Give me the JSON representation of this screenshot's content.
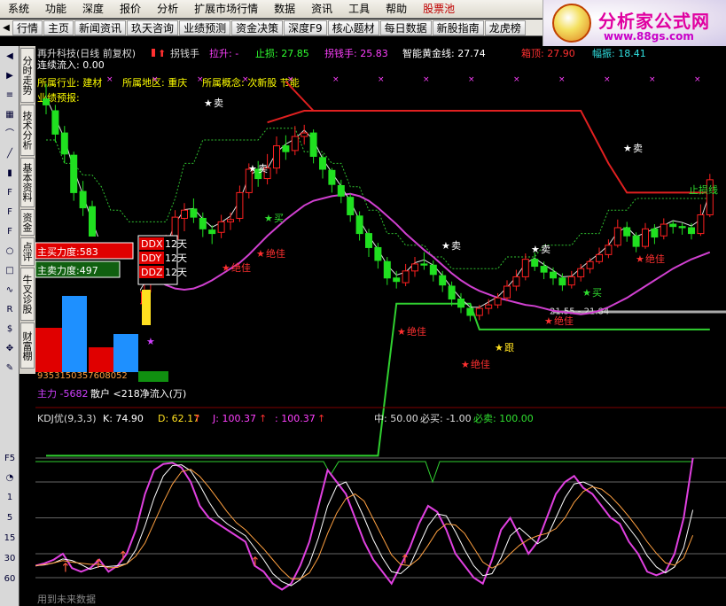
{
  "menu": [
    "系统",
    "功能",
    "深度",
    "报价",
    "分析",
    "扩展市场行情",
    "数据",
    "资讯",
    "工具",
    "帮助",
    "股票池"
  ],
  "tabs": [
    "行情",
    "主页",
    "新闻资讯",
    "玖天咨询",
    "业绩预测",
    "资金决策",
    "深度F9",
    "核心题材",
    "每日数据",
    "新股指南",
    "龙虎榜"
  ],
  "logo": {
    "title": "分析家公式网",
    "url": "www.88gs.com"
  },
  "left_tabs": [
    "分时走势",
    "技术分析",
    "基本资料",
    "资金",
    "点评",
    "牛叉诊股",
    "财富棚"
  ],
  "toolbar_icons": [
    "back-icon",
    "forward-icon",
    "list-icon",
    "grid-icon",
    "chart-icon",
    "line-icon",
    "bar-icon",
    "f10-icon",
    "f-icon",
    "f12-icon",
    "circle-icon",
    "square-icon",
    "wave-icon",
    "rsi-icon",
    "dollar-icon",
    "move-icon",
    "pen-icon",
    "f5-icon",
    "clock-icon",
    "num-icon"
  ],
  "toolbar_nums": [
    "1",
    "5",
    "15",
    "30",
    "60"
  ],
  "main_chart": {
    "title": "再升科技(日线 前复权)",
    "indicator": "拐钱手",
    "lashang": "拉升: -",
    "zhisun": "止损: 27.85",
    "guaiqianshou": "拐钱手: 25.83",
    "zhineng": "智能黄金线: 27.74",
    "xiangding": "箱顶: 27.90",
    "xiangfu": "幅振: 18.41",
    "lianxu": "连续流入: 0.00",
    "hangye": "所属行业: 建材",
    "diqu": "所属地区: 重庆",
    "gainian": "所属概念: 次新股 节能",
    "yeji": "业绩预报:",
    "price_label": "21.55 - 21.84",
    "zhisunxian": "止损线"
  },
  "signals": {
    "sell": "卖",
    "buy": "买",
    "best": "绝佳",
    "follow": "跟"
  },
  "ddx": {
    "ddx": "DDX",
    "ddy": "DDY",
    "ddz": "DDZ",
    "days": "12天",
    "zhumai": "主买力度:583",
    "zhumai2": "主卖力度:497",
    "nums": "9353150357608052",
    "zhuli": "主力 -5682",
    "sanhu": "散户 <218净流入(万)"
  },
  "kdj": {
    "name": "KDJ优(9,3,3)",
    "k": "K: 74.90",
    "d": "D: 62.17",
    "j": "J: 100.37",
    "j2": ": 100.37",
    "zhong": "中: 50.00",
    "bimai": "必买: -1.00",
    "bimai2": "必卖: 100.00",
    "future": "用到未来数据"
  },
  "chart_data": {
    "type": "candlestick",
    "candles": [
      [
        39.5,
        39.0,
        40.8,
        38.2
      ],
      [
        38.5,
        36.5,
        39.0,
        35.8
      ],
      [
        36.6,
        34.8,
        37.2,
        34.0
      ],
      [
        34.7,
        31.5,
        35.0,
        30.8
      ],
      [
        31.6,
        30.2,
        32.5,
        29.5
      ],
      [
        30.3,
        27.0,
        30.8,
        26.2
      ],
      [
        27.0,
        26.1,
        27.5,
        25.1
      ],
      [
        26.2,
        25.0,
        26.9,
        24.2
      ],
      [
        25.1,
        23.2,
        25.8,
        22.9
      ],
      [
        23.3,
        21.9,
        23.9,
        21.4
      ],
      [
        22.0,
        23.0,
        23.5,
        21.5
      ],
      [
        23.0,
        24.6,
        25.0,
        22.8
      ],
      [
        24.7,
        25.6,
        26.3,
        24.4
      ],
      [
        25.7,
        27.4,
        27.9,
        25.5
      ],
      [
        27.5,
        29.4,
        30.0,
        27.2
      ],
      [
        29.3,
        30.0,
        30.6,
        28.2
      ],
      [
        30.1,
        29.4,
        31.0,
        28.9
      ],
      [
        29.3,
        28.4,
        29.8,
        27.7
      ],
      [
        28.3,
        28.0,
        28.7,
        27.1
      ],
      [
        28.1,
        29.0,
        29.6,
        27.6
      ],
      [
        29.0,
        29.2,
        29.8,
        28.3
      ],
      [
        29.3,
        31.5,
        32.1,
        29.0
      ],
      [
        31.5,
        33.5,
        34.0,
        31.0
      ],
      [
        33.5,
        32.7,
        34.2,
        32.0
      ],
      [
        32.7,
        33.6,
        34.8,
        32.2
      ],
      [
        33.6,
        35.5,
        36.3,
        33.1
      ],
      [
        35.5,
        35.0,
        36.4,
        34.3
      ],
      [
        35.1,
        36.3,
        37.2,
        34.7
      ],
      [
        36.3,
        36.6,
        37.3,
        35.6
      ],
      [
        36.6,
        34.6,
        36.9,
        34.0
      ],
      [
        34.5,
        33.5,
        34.8,
        32.7
      ],
      [
        33.4,
        32.2,
        33.6,
        31.5
      ],
      [
        32.1,
        31.2,
        32.6,
        30.6
      ],
      [
        31.1,
        29.6,
        31.4,
        29.0
      ],
      [
        29.5,
        28.0,
        29.9,
        27.4
      ],
      [
        28.0,
        26.8,
        28.4,
        26.0
      ],
      [
        26.8,
        25.7,
        27.2,
        25.0
      ],
      [
        25.6,
        24.2,
        26.0,
        23.6
      ],
      [
        24.2,
        23.9,
        24.8,
        23.3
      ],
      [
        23.8,
        24.8,
        25.4,
        23.5
      ],
      [
        24.8,
        25.4,
        26.0,
        24.3
      ],
      [
        25.4,
        25.3,
        26.4,
        24.9
      ],
      [
        25.3,
        24.5,
        25.7,
        23.9
      ],
      [
        24.4,
        23.6,
        24.8,
        23.0
      ],
      [
        23.5,
        22.4,
        23.9,
        21.8
      ],
      [
        22.4,
        21.7,
        22.9,
        21.2
      ],
      [
        21.6,
        21.0,
        22.0,
        20.5
      ],
      [
        21.0,
        21.6,
        21.9,
        20.6
      ],
      [
        21.6,
        21.9,
        22.4,
        21.1
      ],
      [
        21.9,
        22.5,
        22.9,
        21.6
      ],
      [
        22.5,
        23.5,
        24.0,
        22.2
      ],
      [
        23.5,
        24.3,
        24.9,
        23.1
      ],
      [
        24.3,
        25.8,
        26.3,
        24.0
      ],
      [
        25.8,
        25.2,
        26.4,
        24.8
      ],
      [
        25.2,
        24.7,
        25.6,
        24.1
      ],
      [
        24.7,
        24.2,
        25.1,
        23.6
      ],
      [
        24.2,
        23.6,
        24.6,
        23.1
      ],
      [
        23.6,
        24.3,
        24.8,
        23.3
      ],
      [
        24.3,
        25.0,
        25.4,
        23.9
      ],
      [
        25.0,
        25.6,
        25.9,
        24.6
      ],
      [
        25.6,
        26.2,
        26.8,
        25.4
      ],
      [
        26.2,
        27.0,
        27.5,
        25.9
      ],
      [
        27.0,
        28.5,
        29.2,
        26.8
      ],
      [
        28.5,
        27.8,
        29.0,
        27.3
      ],
      [
        27.8,
        26.9,
        28.1,
        26.4
      ],
      [
        26.9,
        28.4,
        28.9,
        26.7
      ],
      [
        28.4,
        27.7,
        28.8,
        27.1
      ],
      [
        27.8,
        28.8,
        29.3,
        27.5
      ],
      [
        28.8,
        28.6,
        29.1,
        28.0
      ],
      [
        28.6,
        28.5,
        28.9,
        27.9
      ],
      [
        28.5,
        28.0,
        28.9,
        27.5
      ],
      [
        28.0,
        29.6,
        30.5,
        27.8
      ],
      [
        29.6,
        32.6,
        33.1,
        29.4
      ]
    ]
  }
}
